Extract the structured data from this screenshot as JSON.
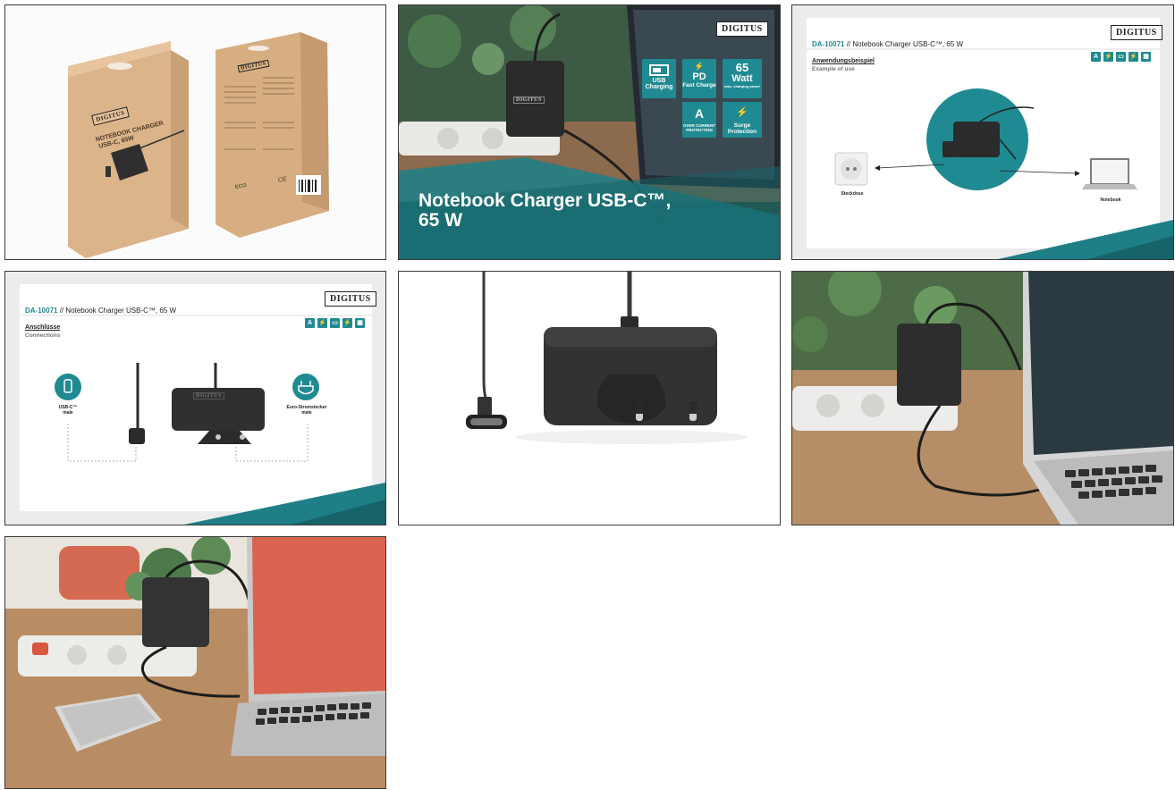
{
  "gallery": {
    "tiles": [
      {
        "id": 1,
        "box_front": {
          "brand": "DIGITUS",
          "title_line1": "NOTEBOOK CHARGER",
          "title_line2": "USB-C, 65W"
        },
        "box_back": {
          "brand": "DIGITUS",
          "eco": "ECO",
          "ce": "CE"
        }
      },
      {
        "id": 2,
        "brand": "DIGITUS",
        "title_line1": "Notebook Charger USB-C™,",
        "title_line2": "65 W",
        "badges": [
          {
            "main": "USB",
            "sub": "Charging"
          },
          {
            "main": "PD",
            "sub": "Fast Charge"
          },
          {
            "main": "65",
            "main2": "Watt",
            "sub": "max. charging power"
          },
          {
            "main": "A",
            "sub": "OVER CURRENT PROTECTION"
          },
          {
            "main": "⚡",
            "sub": "Surge Protection"
          }
        ]
      },
      {
        "id": 3,
        "brand": "DIGITUS",
        "code": "DA-10071",
        "sep": "//",
        "product": "Notebook Charger USB-C™, 65 W",
        "heading": "Anwendungsbeispiel",
        "subheading": "Example of use",
        "left_label": "Steckdose",
        "right_label": "Notebook"
      },
      {
        "id": 4,
        "brand": "DIGITUS",
        "code": "DA-10071",
        "sep": "//",
        "product": "Notebook Charger USB-C™, 65 W",
        "heading": "Anschlüsse",
        "subheading": "Connections",
        "left_label_1": "USB-C™",
        "left_label_2": "male",
        "right_label_1": "Euro-Stromstecker",
        "right_label_2": "male"
      },
      {
        "id": 5
      },
      {
        "id": 6
      },
      {
        "id": 7
      }
    ]
  },
  "colors": {
    "teal": "#1f8a92",
    "dark_teal": "#1f7f86",
    "charger": "#2b2b2b",
    "kraft": "#d9b48a",
    "wood": "#b88a62"
  }
}
